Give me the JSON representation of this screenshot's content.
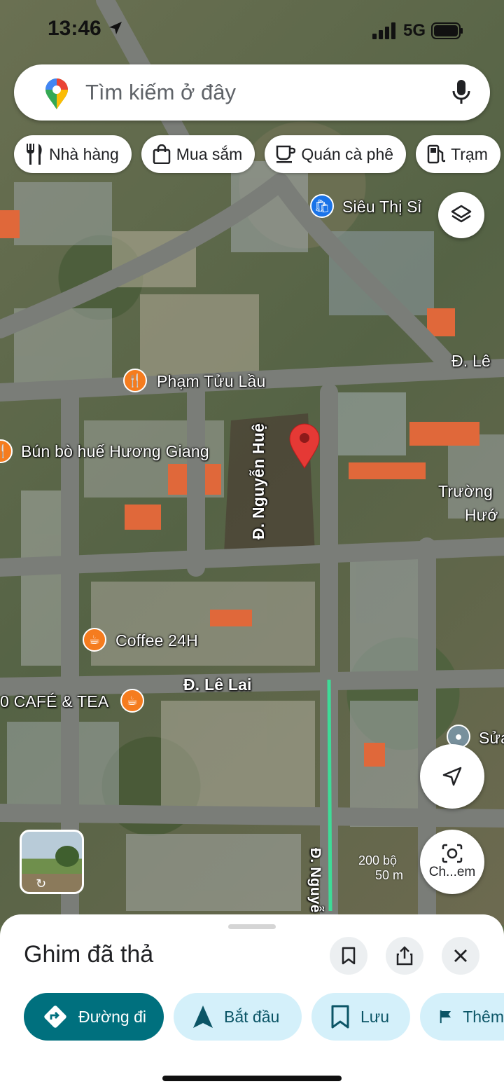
{
  "status_bar": {
    "time": "13:46",
    "network": "5G"
  },
  "search": {
    "placeholder": "Tìm kiếm ở đây"
  },
  "chips": [
    {
      "label": "Nhà hàng",
      "icon": "fork-knife-icon"
    },
    {
      "label": "Mua sắm",
      "icon": "shopping-bag-icon"
    },
    {
      "label": "Quán cà phê",
      "icon": "coffee-cup-icon"
    },
    {
      "label": "Trạm",
      "icon": "gas-station-icon"
    }
  ],
  "map": {
    "places": {
      "sieu_thi": "Siêu Thị Sỉ",
      "pham_tuu_lau": "Phạm Tửu Lầu",
      "bun_bo": "Bún bò huế Hương Giang",
      "coffee24": "Coffee 24H",
      "cafe_tea": "0 CAFÉ & TEA",
      "truong_1": "Trường",
      "truong_2": "Hướ",
      "sua": "Sửa"
    },
    "streets": {
      "le_top": "Đ. Lê",
      "nguyen_hue": "Đ. Nguyễn Huệ",
      "le_lai": "Đ. Lê Lai",
      "nguyen_bottom": "Đ. Nguyễ"
    },
    "scale": {
      "feet": "200 bộ",
      "meters": "50 m"
    },
    "camera_label": "Ch...em",
    "colors": {
      "pin": "#e53935",
      "route": "#3ddc97"
    }
  },
  "sheet": {
    "title": "Ghim đã thả",
    "actions": [
      {
        "label": "Đường đi",
        "icon": "directions-icon"
      },
      {
        "label": "Bắt đầu",
        "icon": "navigation-arrow-icon"
      },
      {
        "label": "Lưu",
        "icon": "bookmark-icon"
      },
      {
        "label": "Thêm",
        "icon": "flag-icon"
      }
    ]
  }
}
